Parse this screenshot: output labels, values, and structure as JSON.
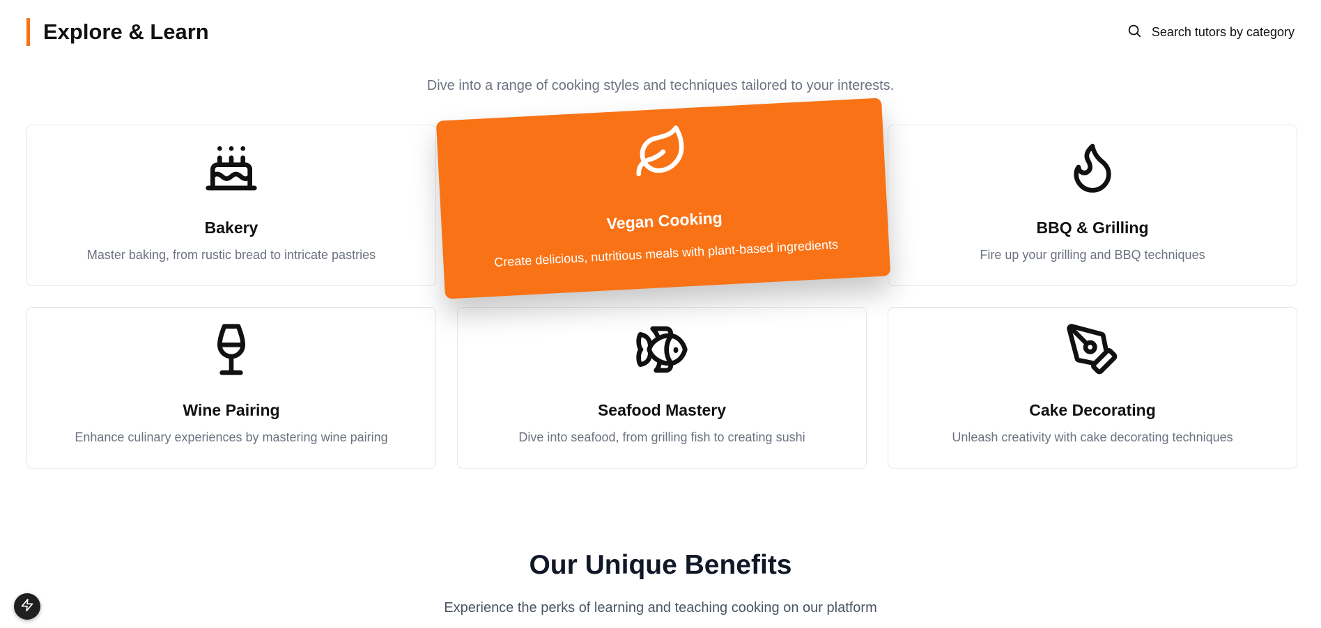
{
  "header": {
    "title": "Explore & Learn",
    "accent_color": "#f97316",
    "search": {
      "icon": "search-icon",
      "label": "Search tutors by category"
    }
  },
  "intro": "Dive into a range of cooking styles and techniques tailored to your interests.",
  "categories": [
    {
      "title": "Bakery",
      "description": "Master baking, from rustic bread to intricate pastries",
      "icon": "cake-icon",
      "featured": false
    },
    {
      "title": "Vegan Cooking",
      "description": "Create delicious, nutritious meals with plant-based ingredients",
      "icon": "leaf-icon",
      "featured": true
    },
    {
      "title": "BBQ & Grilling",
      "description": "Fire up your grilling and BBQ techniques",
      "icon": "flame-icon",
      "featured": false
    },
    {
      "title": "Wine Pairing",
      "description": "Enhance culinary experiences by mastering wine pairing",
      "icon": "wine-glass-icon",
      "featured": false
    },
    {
      "title": "Seafood Mastery",
      "description": "Dive into seafood, from grilling fish to creating sushi",
      "icon": "fish-icon",
      "featured": false
    },
    {
      "title": "Cake Decorating",
      "description": "Unleash creativity with cake decorating techniques",
      "icon": "pen-tool-icon",
      "featured": false
    }
  ],
  "benefits": {
    "title": "Our Unique Benefits",
    "subtitle": "Experience the perks of learning and teaching cooking on our platform"
  },
  "fab": {
    "icon": "lightning-icon"
  },
  "colors": {
    "featured_bg": "#f97316",
    "muted_text": "#6b7280",
    "border": "#e5e7eb"
  }
}
